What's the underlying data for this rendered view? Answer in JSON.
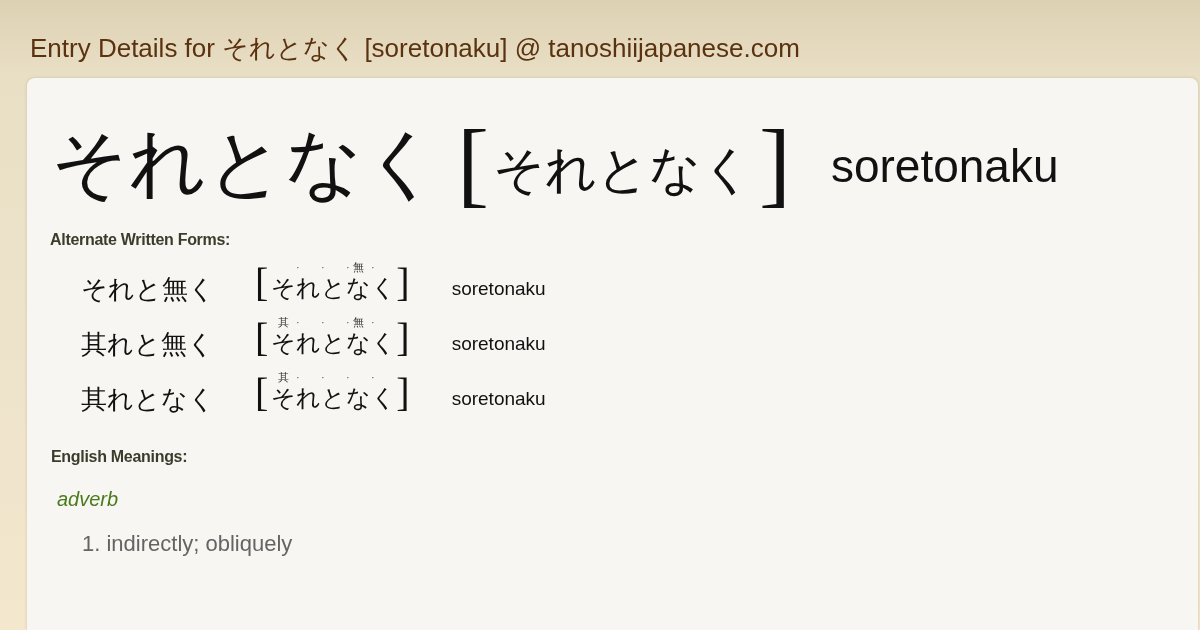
{
  "page_title": "Entry Details for それとなく [soretonaku] @ tanoshiijapanese.com",
  "entry": {
    "headword": "それとなく",
    "reading": {
      "open": "[",
      "text": "それとなく",
      "close": "]"
    },
    "romaji": "soretonaku"
  },
  "alternate_forms": {
    "heading": "Alternate Written Forms:",
    "forms": [
      {
        "written": "それと無く",
        "open": "[",
        "reading": [
          {
            "kana": "そ",
            "mark": "·"
          },
          {
            "kana": "れ",
            "mark": "·"
          },
          {
            "kana": "と",
            "mark": "·"
          },
          {
            "kana": "な",
            "ruby": "無",
            "mark": "·"
          },
          {
            "kana": "く"
          }
        ],
        "close": "]",
        "romaji": "soretonaku"
      },
      {
        "written": "其れと無く",
        "open": "[",
        "reading": [
          {
            "kana": "そ",
            "ruby": "其",
            "mark": "·"
          },
          {
            "kana": "れ",
            "mark": "·"
          },
          {
            "kana": "と",
            "mark": "·"
          },
          {
            "kana": "な",
            "ruby": "無",
            "mark": "·"
          },
          {
            "kana": "く"
          }
        ],
        "close": "]",
        "romaji": "soretonaku"
      },
      {
        "written": "其れとなく",
        "open": "[",
        "reading": [
          {
            "kana": "そ",
            "ruby": "其",
            "mark": "·"
          },
          {
            "kana": "れ",
            "mark": "·"
          },
          {
            "kana": "と",
            "mark": "·"
          },
          {
            "kana": "な",
            "mark": "·"
          },
          {
            "kana": "く"
          }
        ],
        "close": "]",
        "romaji": "soretonaku"
      }
    ]
  },
  "english_meanings": {
    "heading": "English Meanings:",
    "groups": [
      {
        "part_of_speech": "adverb",
        "senses": [
          "1. indirectly; obliquely"
        ]
      }
    ]
  }
}
